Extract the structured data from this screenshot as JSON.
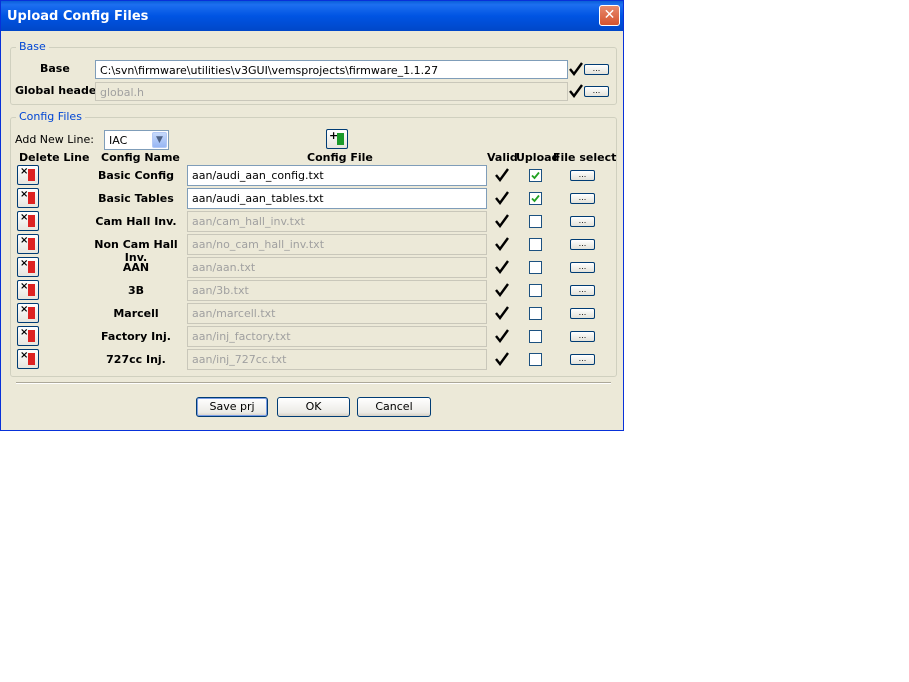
{
  "window": {
    "title": "Upload Config Files",
    "close_glyph": "✕"
  },
  "base_group": {
    "legend": "Base",
    "base_label": "Base",
    "base_value": "C:\\svn\\firmware\\utilities\\v3GUI\\vemsprojects\\firmware_1.1.27",
    "header_label": "Global header",
    "header_value": "global.h",
    "dots": "..."
  },
  "config_group": {
    "legend": "Config Files",
    "add_line_label": "Add New Line:",
    "add_line_selected": "IAC",
    "headers": {
      "delete": "Delete Line",
      "name": "Config Name",
      "file": "Config File",
      "valid": "Valid",
      "upload": "Upload",
      "select": "File select"
    },
    "rows": [
      {
        "name": "Basic Config",
        "file": "aan/audi_aan_config.txt",
        "enabled": true,
        "upload": true
      },
      {
        "name": "Basic Tables",
        "file": "aan/audi_aan_tables.txt",
        "enabled": true,
        "upload": true
      },
      {
        "name": "Cam Hall Inv.",
        "file": "aan/cam_hall_inv.txt",
        "enabled": false,
        "upload": false
      },
      {
        "name": "Non Cam Hall Inv.",
        "file": "aan/no_cam_hall_inv.txt",
        "enabled": false,
        "upload": false
      },
      {
        "name": "AAN",
        "file": "aan/aan.txt",
        "enabled": false,
        "upload": false
      },
      {
        "name": "3B",
        "file": "aan/3b.txt",
        "enabled": false,
        "upload": false
      },
      {
        "name": "Marcell",
        "file": "aan/marcell.txt",
        "enabled": false,
        "upload": false
      },
      {
        "name": "Factory Inj.",
        "file": "aan/inj_factory.txt",
        "enabled": false,
        "upload": false
      },
      {
        "name": "727cc Inj.",
        "file": "aan/inj_727cc.txt",
        "enabled": false,
        "upload": false
      }
    ]
  },
  "buttons": {
    "save": "Save prj",
    "ok": "OK",
    "cancel": "Cancel"
  },
  "icons": {
    "delete": "delete-bookmark-icon",
    "add": "add-bookmark-icon",
    "valid": "checkmark-icon"
  },
  "colors": {
    "titlebar": "#0054e3",
    "legend_text": "#0046d5",
    "dialog_bg": "#ece9d8"
  }
}
